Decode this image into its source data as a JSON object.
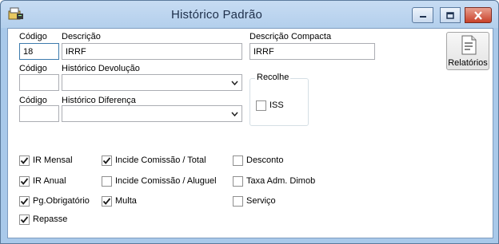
{
  "window": {
    "title": "Histórico Padrão"
  },
  "fields": {
    "codigo_label": "Código",
    "codigo_value": "18",
    "descricao_label": "Descrição",
    "descricao_value": "IRRF",
    "descricao_compacta_label": "Descrição Compacta",
    "descricao_compacta_value": "IRRF",
    "codigo2_label": "Código",
    "codigo2_value": "",
    "historico_devolucao_label": "Histórico Devolução",
    "historico_devolucao_value": "",
    "codigo3_label": "Código",
    "codigo3_value": "",
    "historico_diferenca_label": "Histórico Diferença",
    "historico_diferenca_value": ""
  },
  "recolhe": {
    "legend": "Recolhe",
    "iss_label": "ISS",
    "iss_checked": false
  },
  "toolbar": {
    "relatorios_label": "Relatórios"
  },
  "checks": [
    {
      "label": "IR Mensal",
      "checked": true
    },
    {
      "label": "IR Anual",
      "checked": true
    },
    {
      "label": "Pg.Obrigatório",
      "checked": true
    },
    {
      "label": "Repasse",
      "checked": true
    },
    {
      "label": "Incide Comissão / Total",
      "checked": true
    },
    {
      "label": "Incide Comissão / Aluguel",
      "checked": false
    },
    {
      "label": "Multa",
      "checked": true
    },
    {
      "label": "Desconto",
      "checked": false
    },
    {
      "label": "Taxa Adm. Dimob",
      "checked": false
    },
    {
      "label": "Serviço",
      "checked": false
    }
  ]
}
